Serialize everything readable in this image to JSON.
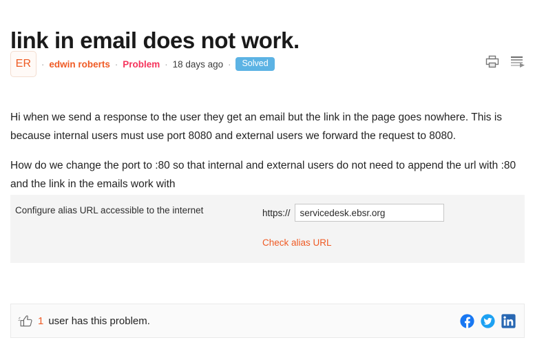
{
  "post": {
    "title": "link in email does not work.",
    "author_initials": "ER",
    "author_name": "edwin roberts",
    "post_type": "Problem",
    "timestamp": "18 days ago",
    "status_badge": "Solved",
    "separator": "·",
    "paragraphs": [
      "Hi when we send a response to the user they get an email but the link in the page goes nowhere. This is because internal users must use port 8080 and external users we forward the request to 8080.",
      "How do we change the port to :80 so that internal and external users do not need to append the url with :80 and the link in the emails work with"
    ]
  },
  "toolbar": {
    "print_icon": "printer-icon",
    "follow_icon": "follow-feed-icon"
  },
  "config_panel": {
    "label": "Configure alias URL accessible to the internet",
    "url_scheme": "https://",
    "url_value": "servicedesk.ebsr.org",
    "url_placeholder": "",
    "check_link": "Check alias URL"
  },
  "footer": {
    "vote_icon": "thumbs-up-icon",
    "vote_count": "1",
    "vote_text": "user has this problem.",
    "social": [
      {
        "name": "facebook-icon",
        "label": "f"
      },
      {
        "name": "twitter-icon",
        "label": "t"
      },
      {
        "name": "linkedin-icon",
        "label": "in"
      }
    ]
  },
  "colors": {
    "accent_orange": "#ef5a24",
    "problem_red": "#f5345c",
    "badge_blue": "#5cb3e4",
    "facebook_blue": "#1877f2",
    "twitter_blue": "#1da1f2",
    "linkedin_blue": "#2867b2",
    "panel_gray": "#f4f4f4"
  }
}
